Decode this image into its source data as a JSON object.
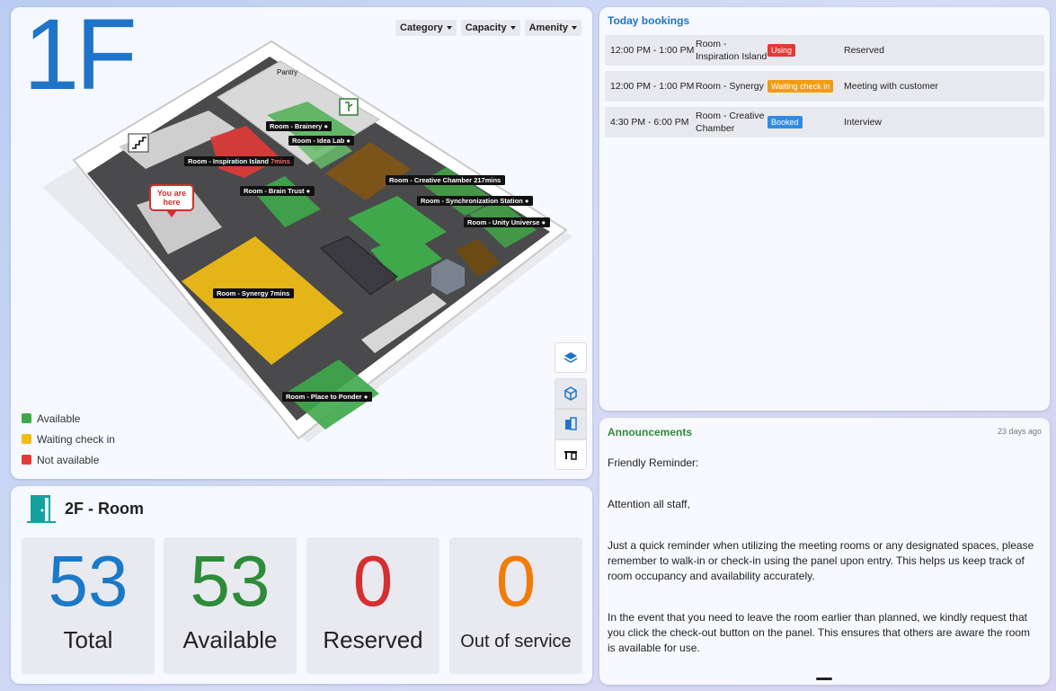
{
  "map": {
    "floor_label": "1F",
    "filters": [
      "Category",
      "Capacity",
      "Amenity"
    ],
    "pantry_label": "Pantry",
    "you_are_here": [
      "You are",
      "here"
    ],
    "rooms": [
      {
        "name": "Room - Brainery",
        "extra": "●"
      },
      {
        "name": "Room - Idea Lab",
        "extra": "●"
      },
      {
        "name": "Room - Inspiration Island",
        "extra": "7mins"
      },
      {
        "name": "Room - Creative Chamber",
        "extra": "217mins"
      },
      {
        "name": "Room - Brain Trust",
        "extra": "●"
      },
      {
        "name": "Room - Synchronization Station",
        "extra": "●"
      },
      {
        "name": "Room - Unity Universe",
        "extra": "●"
      },
      {
        "name": "Room - Synergy",
        "extra": "7mins"
      },
      {
        "name": "Room - Place to Ponder",
        "extra": "●"
      }
    ],
    "legend": [
      {
        "label": "Available",
        "color": "#3ea84a"
      },
      {
        "label": "Waiting check in",
        "color": "#f2bd14"
      },
      {
        "label": "Not available",
        "color": "#e53935"
      }
    ],
    "tool_icons": [
      "layers-icon",
      "cube-icon",
      "floor-icon",
      "desk-icon"
    ]
  },
  "stats": {
    "title": "2F - Room",
    "icon": "door-icon",
    "items": [
      {
        "value": "53",
        "label": "Total",
        "color": "#1b79c8"
      },
      {
        "value": "53",
        "label": "Available",
        "color": "#2e8b3a"
      },
      {
        "value": "0",
        "label": "Reserved",
        "color": "#d62f2f"
      },
      {
        "value": "0",
        "label": "Out of service",
        "color": "#f07c0c"
      }
    ]
  },
  "bookings": {
    "title": "Today bookings",
    "rows": [
      {
        "time": "12:00 PM - 1:00 PM",
        "room": "Room - Inspiration Island",
        "status": "Using",
        "status_color": "#e53935",
        "title": "Reserved"
      },
      {
        "time": "12:00 PM - 1:00 PM",
        "room": "Room - Synergy",
        "status": "Waiting check in",
        "status_color": "#f39c12",
        "title": "Meeting with customer"
      },
      {
        "time": "4:30 PM - 6:00 PM",
        "room": "Room - Creative Chamber",
        "status": "Booked",
        "status_color": "#2f8be6",
        "title": "Interview"
      }
    ]
  },
  "announcements": {
    "title": "Announcements",
    "time": "23 days ago",
    "paragraphs": [
      "Friendly Reminder:",
      "Attention all staff,",
      "Just a quick reminder when utilizing the meeting rooms or any designated spaces, please remember to walk-in or check-in using the panel upon entry. This helps us keep track of room occupancy and availability accurately.",
      "In the event that you need to leave the room earlier than planned, we kindly request that you click the check-out button on the panel. This ensures that others are aware the room is available for use."
    ]
  }
}
